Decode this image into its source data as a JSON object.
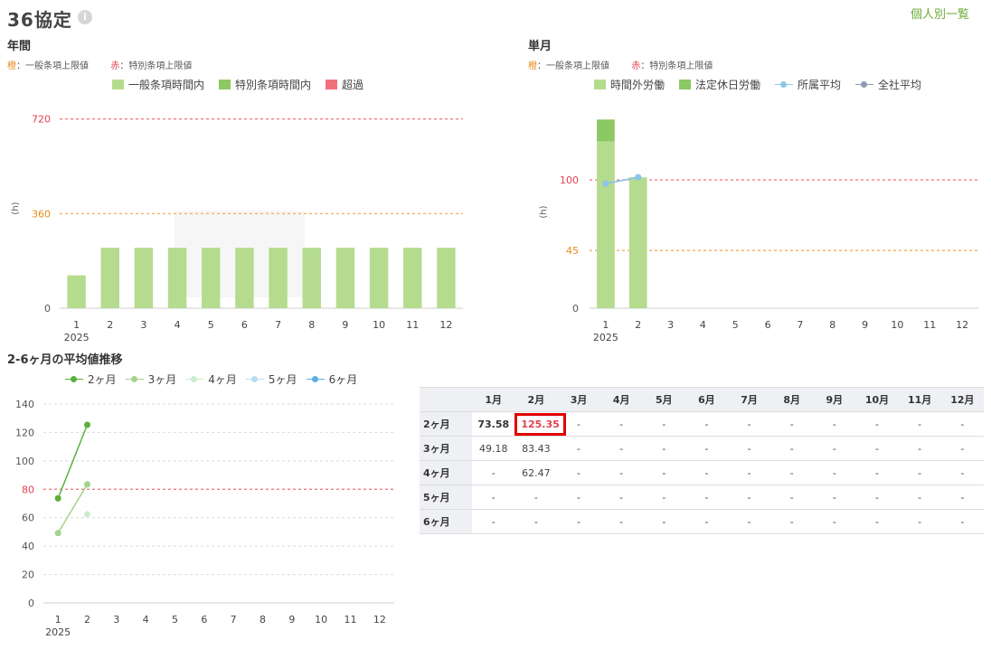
{
  "page": {
    "title": "36協定",
    "info_icon_glyph": "i",
    "top_link": "個人別一覧"
  },
  "annual": {
    "title": "年間",
    "note_orange_key": "橙",
    "note_orange_text": "：一般条項上限値",
    "note_red_key": "赤",
    "note_red_text": "：特別条項上限値",
    "legend": [
      {
        "label": "一般条項時間内",
        "color": "#b5dc8e"
      },
      {
        "label": "特別条項時間内",
        "color": "#8cc863"
      },
      {
        "label": "超過",
        "color": "#f0717c"
      }
    ]
  },
  "monthly": {
    "title": "単月",
    "note_orange_key": "橙",
    "note_orange_text": "：一般条項上限値",
    "note_red_key": "赤",
    "note_red_text": "：特別条項上限値",
    "legend": [
      {
        "label": "時間外労働",
        "color": "#b5dc8e",
        "kind": "box"
      },
      {
        "label": "法定休日労働",
        "color": "#8cc863",
        "kind": "box"
      },
      {
        "label": "所属平均",
        "color": "#8ec6ea",
        "kind": "line"
      },
      {
        "label": "全社平均",
        "color": "#8d9bb3",
        "kind": "line"
      }
    ]
  },
  "trend": {
    "title": "2-6ヶ月の平均値推移",
    "legend": [
      {
        "label": "2ヶ月",
        "color": "#5ab03c"
      },
      {
        "label": "3ヶ月",
        "color": "#a3d48a"
      },
      {
        "label": "4ヶ月",
        "color": "#cdeccd"
      },
      {
        "label": "5ヶ月",
        "color": "#b9dcf3"
      },
      {
        "label": "6ヶ月",
        "color": "#5aaee0"
      }
    ]
  },
  "table": {
    "corner": "",
    "columns": [
      "1月",
      "2月",
      "3月",
      "4月",
      "5月",
      "6月",
      "7月",
      "8月",
      "9月",
      "10月",
      "11月",
      "12月"
    ],
    "rows": [
      {
        "label": "2ヶ月",
        "cells": [
          "73.58",
          "125.35",
          "-",
          "-",
          "-",
          "-",
          "-",
          "-",
          "-",
          "-",
          "-",
          "-"
        ]
      },
      {
        "label": "3ヶ月",
        "cells": [
          "49.18",
          "83.43",
          "-",
          "-",
          "-",
          "-",
          "-",
          "-",
          "-",
          "-",
          "-",
          "-"
        ]
      },
      {
        "label": "4ヶ月",
        "cells": [
          "-",
          "62.47",
          "-",
          "-",
          "-",
          "-",
          "-",
          "-",
          "-",
          "-",
          "-",
          "-"
        ]
      },
      {
        "label": "5ヶ月",
        "cells": [
          "-",
          "-",
          "-",
          "-",
          "-",
          "-",
          "-",
          "-",
          "-",
          "-",
          "-",
          "-"
        ]
      },
      {
        "label": "6ヶ月",
        "cells": [
          "-",
          "-",
          "-",
          "-",
          "-",
          "-",
          "-",
          "-",
          "-",
          "-",
          "-",
          "-"
        ]
      }
    ]
  },
  "chart_data": [
    {
      "type": "bar",
      "title": "年間",
      "ylabel": "(h)",
      "ylim": [
        0,
        760
      ],
      "yticks": [
        0,
        360,
        720
      ],
      "ytick_colors": {
        "0": "#555555",
        "360": "#e88a1a",
        "720": "#e0424f"
      },
      "reference_lines": [
        {
          "value": 360,
          "color": "#f2a64a"
        },
        {
          "value": 720,
          "color": "#f0717c"
        }
      ],
      "categories": [
        "1",
        "2",
        "3",
        "4",
        "5",
        "6",
        "7",
        "8",
        "9",
        "10",
        "11",
        "12"
      ],
      "x_year_label": "2025",
      "series": [
        {
          "name": "一般条項時間内",
          "color": "#b5dc8e",
          "values": [
            125,
            230,
            230,
            230,
            230,
            230,
            230,
            230,
            230,
            230,
            230,
            230
          ]
        }
      ],
      "grid": false
    },
    {
      "type": "bar",
      "title": "単月",
      "ylabel": "(h)",
      "ylim": [
        0,
        150
      ],
      "yticks": [
        0,
        45,
        100
      ],
      "ytick_colors": {
        "0": "#555555",
        "45": "#e88a1a",
        "100": "#e0424f"
      },
      "reference_lines": [
        {
          "value": 45,
          "color": "#f2a64a"
        },
        {
          "value": 100,
          "color": "#f0717c"
        }
      ],
      "categories": [
        "1",
        "2",
        "3",
        "4",
        "5",
        "6",
        "7",
        "8",
        "9",
        "10",
        "11",
        "12"
      ],
      "x_year_label": "2025",
      "series": [
        {
          "name": "時間外労働",
          "color": "#b5dc8e",
          "values": [
            130,
            102,
            null,
            null,
            null,
            null,
            null,
            null,
            null,
            null,
            null,
            null
          ]
        },
        {
          "name": "法定休日労働",
          "color": "#8cc863",
          "values": [
            17,
            0,
            null,
            null,
            null,
            null,
            null,
            null,
            null,
            null,
            null,
            null
          ]
        }
      ],
      "lines": [
        {
          "name": "全社平均",
          "color": "#8d9bb3",
          "values": [
            97,
            102,
            null,
            null,
            null,
            null,
            null,
            null,
            null,
            null,
            null,
            null
          ]
        },
        {
          "name": "所属平均",
          "color": "#8ec6ea",
          "values": [
            97,
            102,
            null,
            null,
            null,
            null,
            null,
            null,
            null,
            null,
            null,
            null
          ]
        }
      ],
      "grid": false
    },
    {
      "type": "line",
      "title": "2-6ヶ月の平均値推移",
      "ylim": [
        0,
        140
      ],
      "yticks": [
        0,
        20,
        40,
        60,
        80,
        100,
        120,
        140
      ],
      "ytick_colors": {
        "80": "#e0424f"
      },
      "reference_lines": [
        {
          "value": 80,
          "color": "#f0717c"
        }
      ],
      "categories": [
        "1",
        "2",
        "3",
        "4",
        "5",
        "6",
        "7",
        "8",
        "9",
        "10",
        "11",
        "12"
      ],
      "x_year_label": "2025",
      "series": [
        {
          "name": "2ヶ月",
          "color": "#5ab03c",
          "values": [
            73.58,
            125.35,
            null,
            null,
            null,
            null,
            null,
            null,
            null,
            null,
            null,
            null
          ]
        },
        {
          "name": "3ヶ月",
          "color": "#a3d48a",
          "values": [
            49.18,
            83.43,
            null,
            null,
            null,
            null,
            null,
            null,
            null,
            null,
            null,
            null
          ]
        },
        {
          "name": "4ヶ月",
          "color": "#cdeccd",
          "values": [
            null,
            62.47,
            null,
            null,
            null,
            null,
            null,
            null,
            null,
            null,
            null,
            null
          ]
        },
        {
          "name": "5ヶ月",
          "color": "#b9dcf3",
          "values": [
            null,
            null,
            null,
            null,
            null,
            null,
            null,
            null,
            null,
            null,
            null,
            null
          ]
        },
        {
          "name": "6ヶ月",
          "color": "#5aaee0",
          "values": [
            null,
            null,
            null,
            null,
            null,
            null,
            null,
            null,
            null,
            null,
            null,
            null
          ]
        }
      ],
      "grid": true
    }
  ]
}
